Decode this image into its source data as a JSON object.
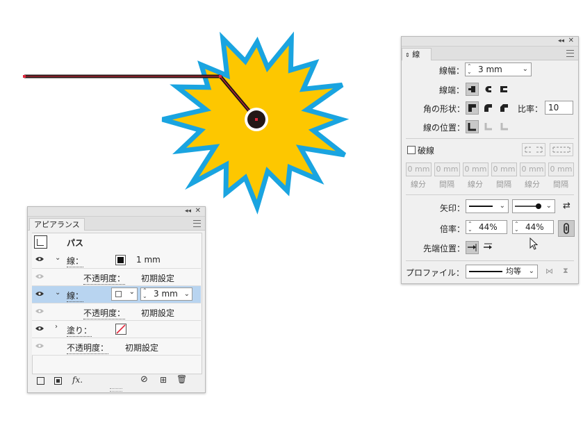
{
  "colors": {
    "starFill": "#fdc700",
    "starStroke": "#1aa4e0",
    "lineStroke": "#231816",
    "selection": "#e0283c",
    "rowHighlight": "#b8d4f0"
  },
  "strokePanel": {
    "tab": "線",
    "collapse_icon": "double-chevron-left-icon",
    "close_icon": "close-icon",
    "weight_label": "線幅：",
    "weight_value": "3 mm",
    "cap_label": "線端：",
    "corner_label": "角の形状：",
    "limit_label": "比率：",
    "limit_value": "10",
    "align_label": "線の位置：",
    "dashed_label": "破線",
    "dashed_checked": false,
    "dash_values": [
      "0 mm",
      "0 mm",
      "0 mm",
      "0 mm",
      "0 mm",
      "0 mm"
    ],
    "dash_labels": [
      "線分",
      "間隔",
      "線分",
      "間隔",
      "線分",
      "間隔"
    ],
    "arrow_label": "矢印：",
    "scale_label": "倍率：",
    "scale_start": "44%",
    "scale_end": "44%",
    "tip_label": "先端位置：",
    "profile_label": "プロファイル：",
    "profile_value": "均等"
  },
  "appearancePanel": {
    "tab": "アピアランス",
    "title": "パス",
    "rows": [
      {
        "label": "線：",
        "value": "1 mm"
      },
      {
        "label": "不透明度：",
        "value": "初期設定"
      },
      {
        "label": "線：",
        "value": "3 mm"
      },
      {
        "label": "不透明度：",
        "value": "初期設定"
      },
      {
        "label": "塗り：",
        "value": ""
      },
      {
        "label": "不透明度：",
        "value": "初期設定"
      }
    ],
    "fx_label": "fx."
  }
}
